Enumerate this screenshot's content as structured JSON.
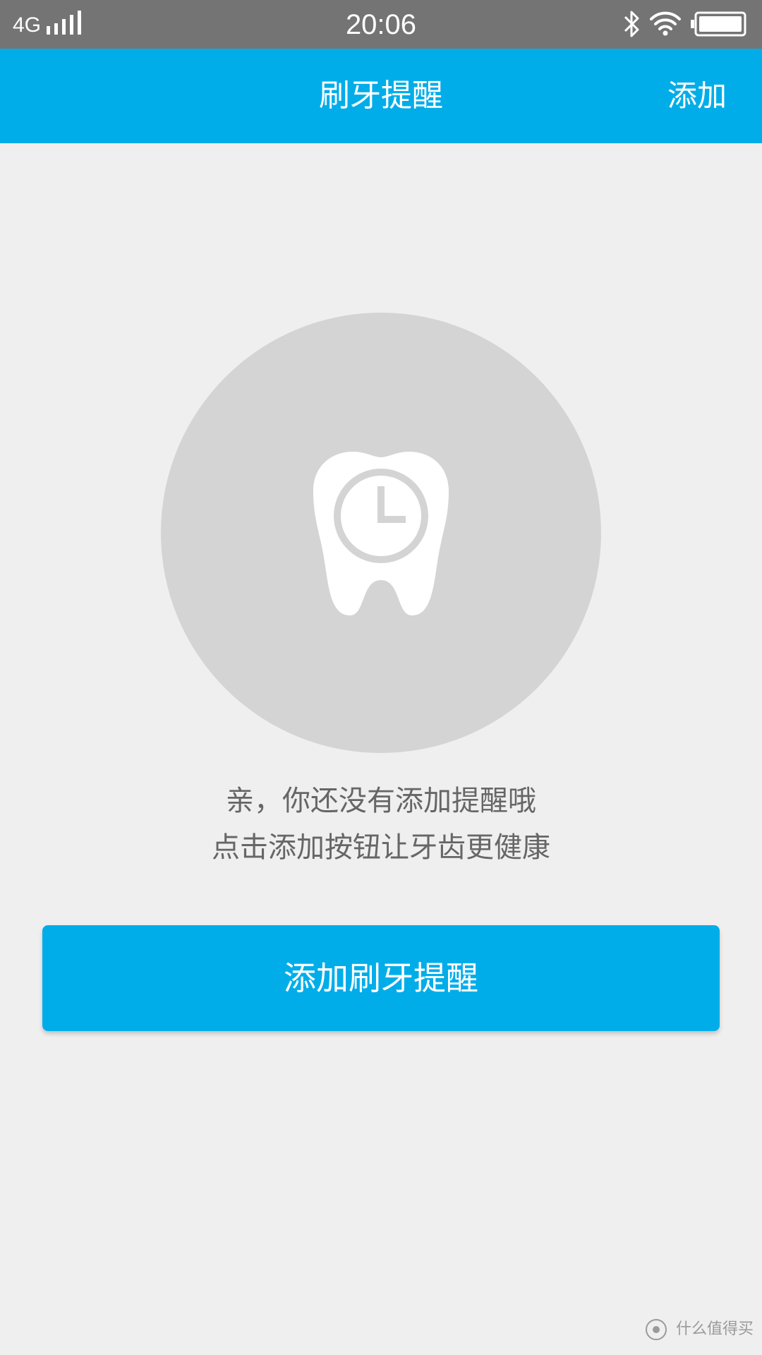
{
  "status_bar": {
    "network": "4G",
    "time": "20:06",
    "icons": [
      "signal-icon",
      "bluetooth-icon",
      "wifi-icon",
      "battery-icon"
    ]
  },
  "app_bar": {
    "title": "刷牙提醒",
    "action_label": "添加"
  },
  "empty_state": {
    "icon": "tooth-clock-icon",
    "line1": "亲，你还没有添加提醒哦",
    "line2": "点击添加按钮让牙齿更健康"
  },
  "primary_button": {
    "label": "添加刷牙提醒"
  },
  "watermark": {
    "text": "什么值得买"
  },
  "colors": {
    "accent": "#00ade9",
    "status_bar": "#747474",
    "background": "#efefef",
    "circle": "#d4d4d4",
    "text_muted": "#666666"
  }
}
